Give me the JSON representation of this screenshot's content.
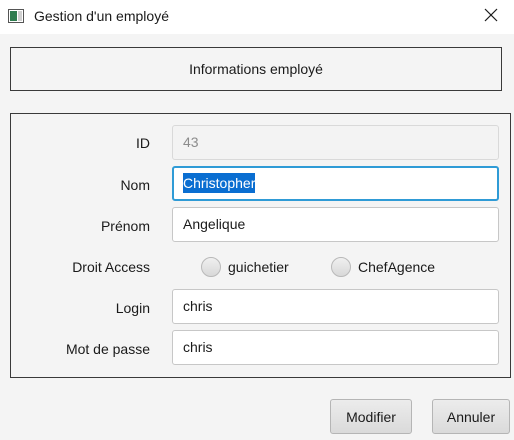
{
  "window": {
    "title": "Gestion d'un employé",
    "icon": "app-window-icon",
    "close_icon": "close-icon"
  },
  "header": {
    "title": "Informations employé"
  },
  "form": {
    "id": {
      "label": "ID",
      "value": "43",
      "disabled": true
    },
    "nom": {
      "label": "Nom",
      "value": "Christopher",
      "focused": true,
      "text_selected": true
    },
    "prenom": {
      "label": "Prénom",
      "value": "Angelique"
    },
    "droit_access": {
      "label": "Droit Access",
      "options": [
        {
          "label": "guichetier",
          "selected": false
        },
        {
          "label": "ChefAgence",
          "selected": false
        }
      ]
    },
    "login": {
      "label": "Login",
      "value": "chris"
    },
    "password": {
      "label": "Mot de passe",
      "value": "chris"
    }
  },
  "actions": {
    "modify_label": "Modifier",
    "cancel_label": "Annuler"
  },
  "colors": {
    "focus_border": "#2f9bd6",
    "selection_bg": "#0a6ed1",
    "window_bg": "#f4f4f4"
  }
}
